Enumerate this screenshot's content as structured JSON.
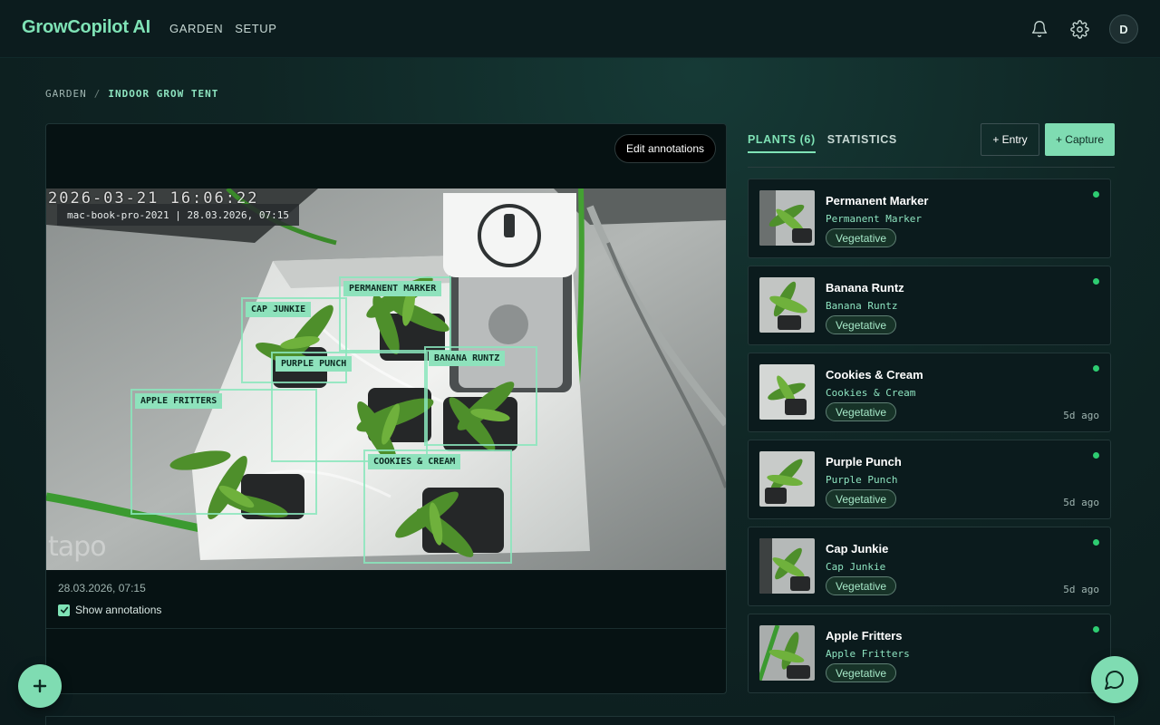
{
  "app": {
    "brand": "GrowCopilot AI",
    "user_initial": "D"
  },
  "nav": {
    "items": [
      "GARDEN",
      "SETUP"
    ]
  },
  "breadcrumb": {
    "root": "GARDEN",
    "separator": "/",
    "current": "INDOOR GROW TENT"
  },
  "camera": {
    "edit_label": "Edit annotations",
    "osd_date": "2026-03-21 16:06:22",
    "osd_label": "mac-book-pro-2021 | 28.03.2026, 07:15",
    "watermark": "tapo",
    "timestamp": "28.03.2026, 07:15",
    "show_annotations_label": "Show annotations",
    "show_annotations": true,
    "annotations": [
      "PERMANENT MARKER",
      "CAP JUNKIE",
      "PURPLE PUNCH",
      "BANANA RUNTZ",
      "APPLE FRITTERS",
      "COOKIES & CREAM"
    ]
  },
  "tabs": [
    {
      "label": "PLANTS (6)",
      "active": true
    },
    {
      "label": "STATISTICS",
      "active": false
    }
  ],
  "actions": {
    "entry": "+ Entry",
    "capture": "+ Capture"
  },
  "plants": [
    {
      "name": "Permanent Marker",
      "strain": "Permanent Marker",
      "stage": "Vegetative",
      "age": ""
    },
    {
      "name": "Banana Runtz",
      "strain": "Banana Runtz",
      "stage": "Vegetative",
      "age": ""
    },
    {
      "name": "Cookies & Cream",
      "strain": "Cookies & Cream",
      "stage": "Vegetative",
      "age": "5d ago"
    },
    {
      "name": "Purple Punch",
      "strain": "Purple Punch",
      "stage": "Vegetative",
      "age": "5d ago"
    },
    {
      "name": "Cap Junkie",
      "strain": "Cap Junkie",
      "stage": "Vegetative",
      "age": "5d ago"
    },
    {
      "name": "Apple Fritters",
      "strain": "Apple Fritters",
      "stage": "Vegetative",
      "age": ""
    }
  ],
  "colors": {
    "accent": "#7fe3b6",
    "status_online": "#2ecc71",
    "background": "#0f2322"
  },
  "icons": {
    "notifications": "bell-icon",
    "settings": "gear-icon",
    "add": "plus-icon",
    "chat": "chat-bubble-icon",
    "check": "check-icon"
  }
}
